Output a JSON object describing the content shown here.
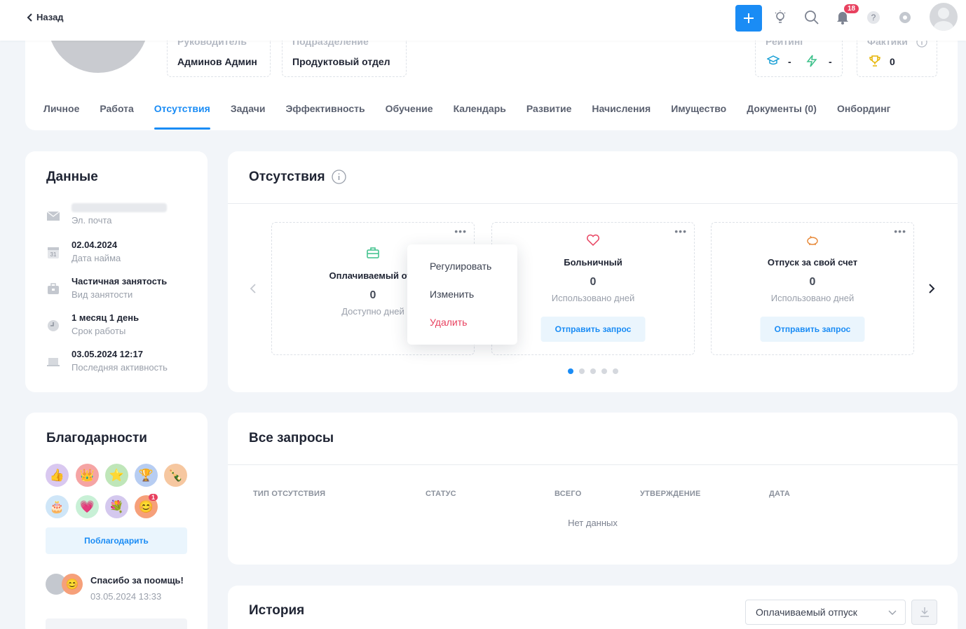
{
  "topbar": {
    "back_label": "Назад",
    "notifications_count": "18"
  },
  "profile": {
    "manager_label": "Руководитель",
    "manager_value": "Админов Админ",
    "department_label": "Подразделение",
    "department_value": "Продуктовый отдел",
    "rating_label": "Рейтинг",
    "rating_value_1": "-",
    "rating_value_2": "-",
    "facts_label": "Фактики",
    "facts_value": "0"
  },
  "tabs": [
    {
      "label": "Личное"
    },
    {
      "label": "Работа"
    },
    {
      "label": "Отсутствия"
    },
    {
      "label": "Задачи"
    },
    {
      "label": "Эффективность"
    },
    {
      "label": "Обучение"
    },
    {
      "label": "Календарь"
    },
    {
      "label": "Развитие"
    },
    {
      "label": "Начисления"
    },
    {
      "label": "Имущество"
    },
    {
      "label": "Документы (0)"
    },
    {
      "label": "Онбординг"
    }
  ],
  "data_card": {
    "title": "Данные",
    "rows": [
      {
        "value": "",
        "label": "Эл. почта",
        "icon": "mail-icon"
      },
      {
        "value": "02.04.2024",
        "label": "Дата найма",
        "icon": "calendar-icon"
      },
      {
        "value": "Частичная занятость",
        "label": "Вид занятости",
        "icon": "briefcase-icon"
      },
      {
        "value": "1 месяц 1 день",
        "label": "Срок работы",
        "icon": "clock-icon"
      },
      {
        "value": "03.05.2024 12:17",
        "label": "Последняя активность",
        "icon": "laptop-icon"
      }
    ]
  },
  "absences": {
    "title": "Отсутствия",
    "cards": [
      {
        "name": "Оплачиваемый отп",
        "count": "0",
        "sub": "Доступно дней"
      },
      {
        "name": "Больничный",
        "count": "0",
        "sub": "Использовано дней",
        "button": "Отправить запрос"
      },
      {
        "name": "Отпуск за свой счет",
        "count": "0",
        "sub": "Использовано дней",
        "button": "Отправить запрос"
      }
    ],
    "menu": [
      "Регулировать",
      "Изменить",
      "Удалить"
    ]
  },
  "thanks": {
    "title": "Благодарности",
    "button": "Поблагодарить",
    "emoji_badge": "1",
    "message": "Спасибо за поомщь!",
    "message_date": "03.05.2024 13:33"
  },
  "requests": {
    "title": "Все запросы",
    "columns": [
      "ТИП ОТСУТСТВИЯ",
      "СТАТУС",
      "ВСЕГО",
      "УТВЕРЖДЕНИЕ",
      "ДАТА"
    ],
    "empty": "Нет данных"
  },
  "history": {
    "title": "История",
    "select_value": "Оплачиваемый отпуск"
  },
  "colors": {
    "accent": "#1a8cf5",
    "danger": "#e8415f"
  }
}
